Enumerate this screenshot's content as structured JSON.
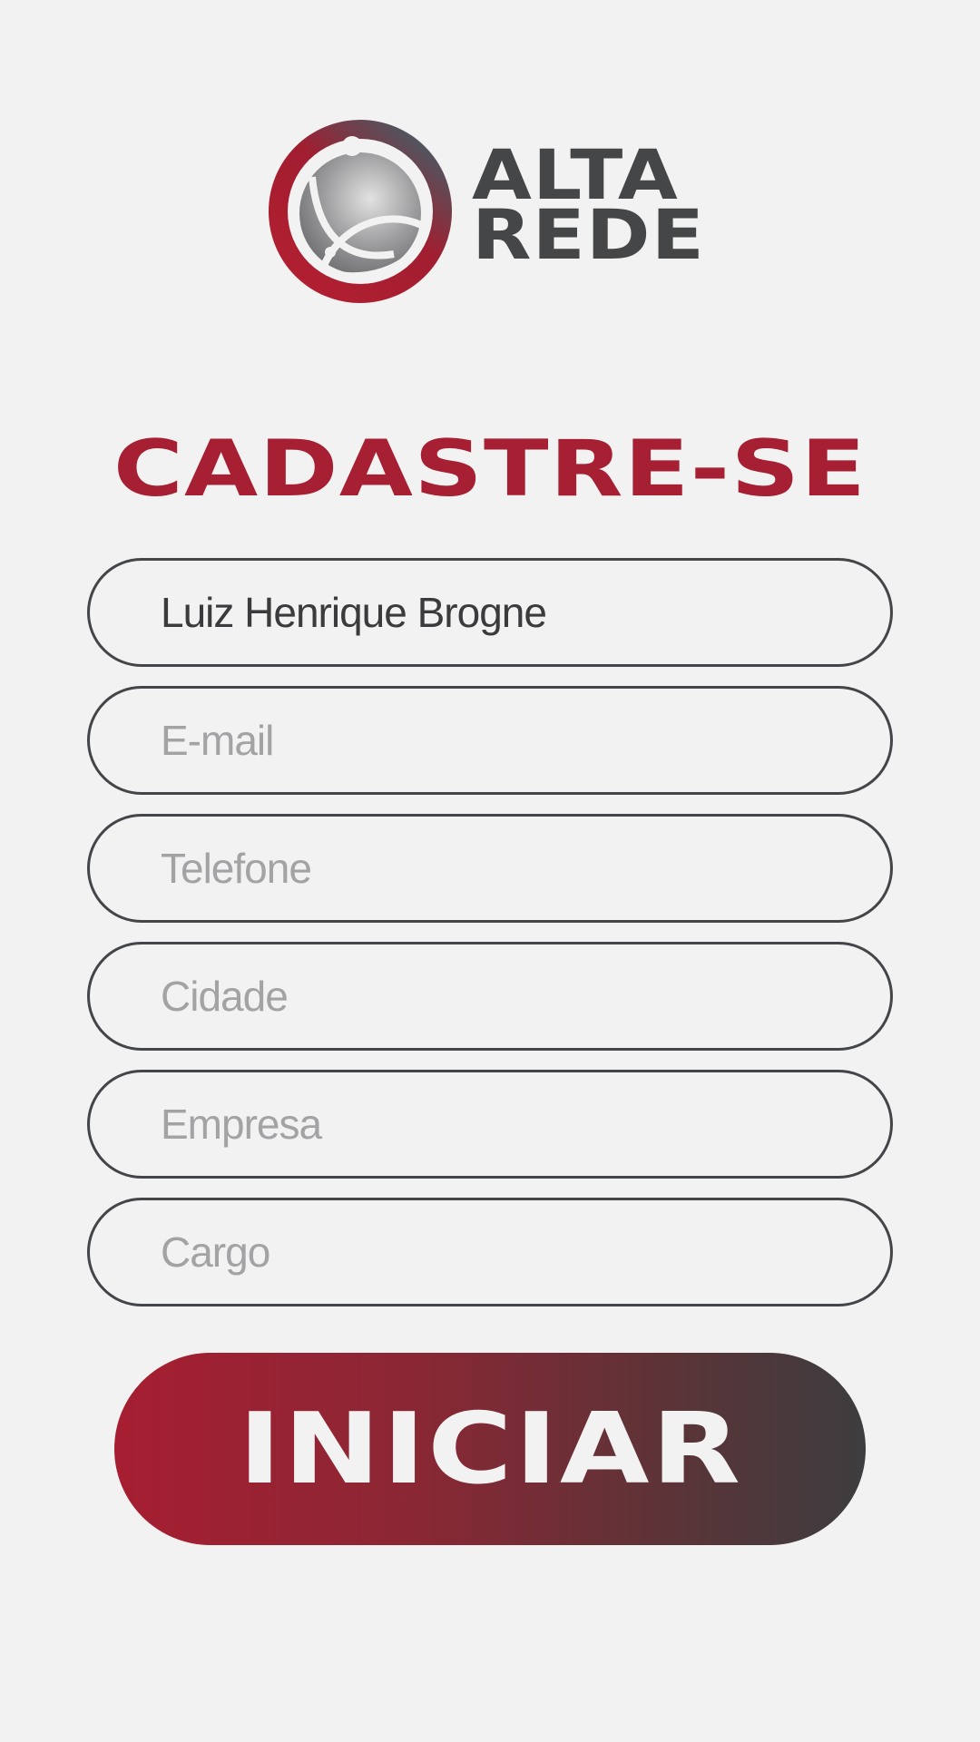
{
  "brand": {
    "line1": "ALTA",
    "line2": "REDE",
    "logo_icon": "globe-satellite-icon",
    "colors": {
      "red": "#a61f32",
      "gray": "#454648"
    }
  },
  "title": "CADASTRE-SE",
  "fields": [
    {
      "name": "nome",
      "value": "Luiz Henrique Brogne",
      "placeholder": ""
    },
    {
      "name": "email",
      "value": "",
      "placeholder": "E-mail"
    },
    {
      "name": "telefone",
      "value": "",
      "placeholder": "Telefone"
    },
    {
      "name": "cidade",
      "value": "",
      "placeholder": "Cidade"
    },
    {
      "name": "empresa",
      "value": "",
      "placeholder": "Empresa"
    },
    {
      "name": "cargo",
      "value": "",
      "placeholder": "Cargo"
    }
  ],
  "submit": {
    "label": "INICIAR",
    "gradient": [
      "#a61e31",
      "#3d3d3f"
    ]
  }
}
